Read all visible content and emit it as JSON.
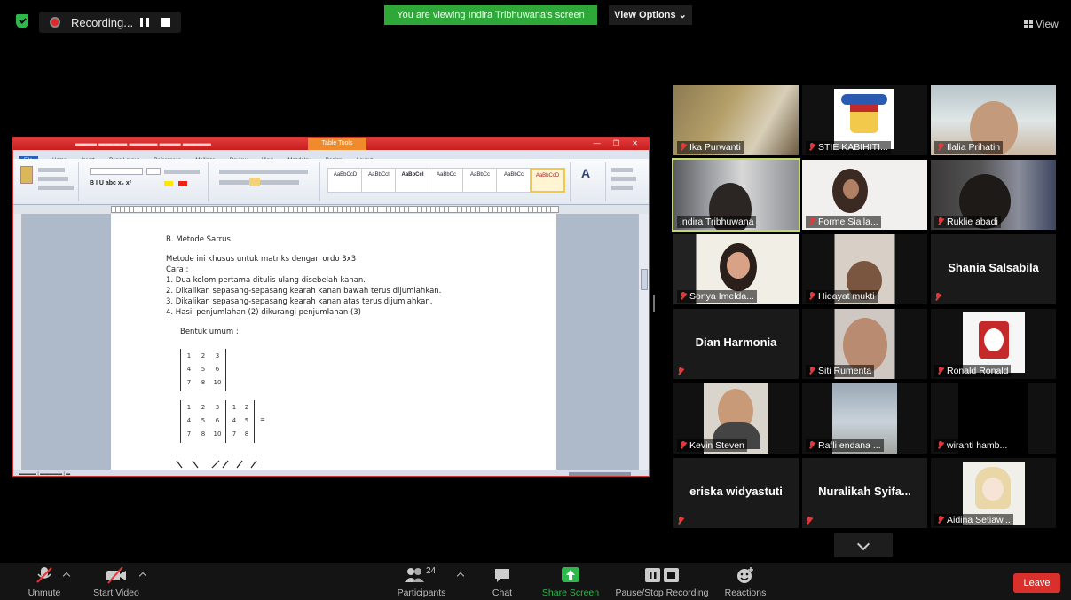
{
  "top_bar": {
    "recording_label": "Recording...",
    "viewing_banner": "You are viewing Indira Tribhuwana's screen",
    "view_options": "View Options",
    "view_label": "View"
  },
  "shared_document": {
    "title_bar_context": "Table Tools",
    "ribbon_tabs": [
      "File",
      "Home",
      "Insert",
      "Page Layout",
      "References",
      "Mailings",
      "Review",
      "View",
      "Mendeley",
      "Design",
      "Layout"
    ],
    "style_names": [
      "AaBbCcD",
      "AaBbCcI",
      "AaBbCcI",
      "AaBbCc",
      "AaBbCc",
      "AaBbCc",
      "AaBbCcD"
    ],
    "heading": "B.  Metode Sarrus.",
    "intro": "Metode ini khusus untuk matriks dengan ordo 3x3",
    "cara": "Cara :",
    "steps": [
      "1.   Dua kolom pertama ditulis ulang disebelah kanan.",
      "2.   Dikalikan sepasang-sepasang kearah kanan bawah terus dijumlahkan.",
      "3.   Dikalikan sepasang-sepasang kearah kanan atas terus dijumlahkan.",
      "4.   Hasil penjumlahan (2) dikurangi penjumlahan (3)"
    ],
    "bentuk_umum": "Bentuk umum :",
    "matrix_a": [
      [
        "1",
        "2",
        "3"
      ],
      [
        "4",
        "5",
        "6"
      ],
      [
        "7",
        "8",
        "10"
      ]
    ],
    "matrix_b": [
      [
        "1",
        "2",
        "3"
      ],
      [
        "4",
        "5",
        "6"
      ],
      [
        "7",
        "8",
        "10"
      ]
    ],
    "matrix_b_ext": [
      [
        "1",
        "2"
      ],
      [
        "4",
        "5"
      ],
      [
        "7",
        "8"
      ]
    ],
    "equals": "="
  },
  "participants": [
    {
      "name": "Ika Purwanti",
      "type": "video"
    },
    {
      "name": "STIE KABIHITI...",
      "type": "video"
    },
    {
      "name": "Ilalia Prihatin",
      "type": "video"
    },
    {
      "name": "Indira Tribhuwana",
      "type": "video",
      "active": true
    },
    {
      "name": "Forme Sialla...",
      "type": "video"
    },
    {
      "name": "Ruklie abadi",
      "type": "video"
    },
    {
      "name": "Sonya Imelda...",
      "type": "video"
    },
    {
      "name": "Hidayat mukti",
      "type": "video"
    },
    {
      "name": "Shania Salsabila",
      "type": "name"
    },
    {
      "name": "Dian Harmonia",
      "type": "name"
    },
    {
      "name": "Siti Rumenta",
      "type": "video"
    },
    {
      "name": "Ronald Ronald",
      "type": "video"
    },
    {
      "name": "Kevin Steven",
      "type": "video"
    },
    {
      "name": "Rafli endana ...",
      "type": "video"
    },
    {
      "name": "wiranti hamb...",
      "type": "video"
    },
    {
      "name": "eriska widyastuti",
      "type": "name"
    },
    {
      "name": "Nuralikah  Syifa...",
      "type": "name"
    },
    {
      "name": "Aidina Setiaw...",
      "type": "video"
    }
  ],
  "toolbar": {
    "unmute": "Unmute",
    "start_video": "Start Video",
    "participants": "Participants",
    "participant_count": "24",
    "chat": "Chat",
    "share_screen": "Share Screen",
    "pause_stop_recording": "Pause/Stop Recording",
    "reactions": "Reactions",
    "leave": "Leave"
  },
  "colors": {
    "banner_green": "#2fa83a",
    "share_green": "#2db84d",
    "leave_red": "#d9302b",
    "active_border": "#c6d86a",
    "muted_red": "#e23a3a"
  }
}
